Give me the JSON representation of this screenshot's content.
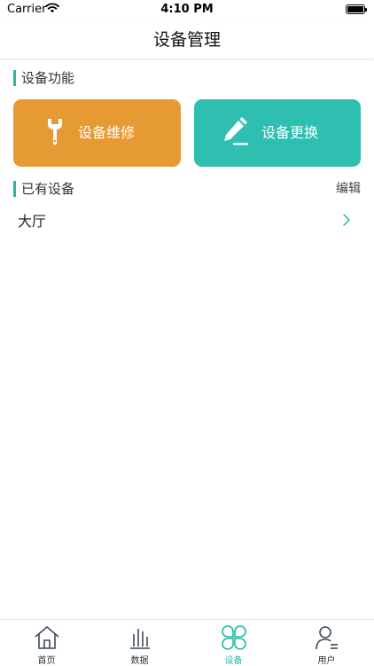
{
  "status_bar": {
    "carrier": "Carrier",
    "time": "4:10 PM"
  },
  "nav": {
    "title": "设备管理"
  },
  "functions_section": {
    "title": "设备功能",
    "buttons": [
      {
        "label": "设备维修",
        "icon": "wrench-icon",
        "color": "#e69a34"
      },
      {
        "label": "设备更换",
        "icon": "pencil-icon",
        "color": "#2ebfb0"
      }
    ]
  },
  "devices_section": {
    "title": "已有设备",
    "edit_label": "编辑",
    "items": [
      {
        "name": "大厅"
      }
    ]
  },
  "tab_bar": {
    "active_color": "#22b8a6",
    "tabs": [
      {
        "label": "首页",
        "icon": "home-icon"
      },
      {
        "label": "数据",
        "icon": "bar-chart-icon"
      },
      {
        "label": "设备",
        "icon": "clover-icon",
        "active": true
      },
      {
        "label": "用户",
        "icon": "user-icon"
      }
    ]
  }
}
